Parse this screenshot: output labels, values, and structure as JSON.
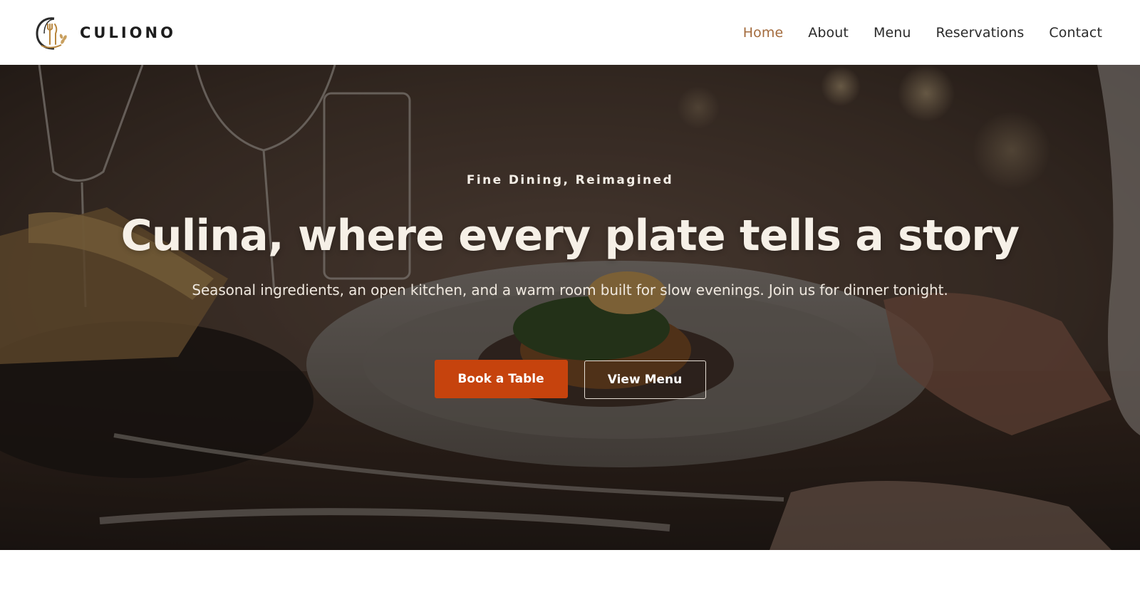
{
  "brand": {
    "name": "CULIONO",
    "logo_icon": "fork-knife-wheat-logo",
    "accent": "#a36b3d"
  },
  "nav": {
    "items": [
      {
        "label": "Home",
        "active": true
      },
      {
        "label": "About",
        "active": false
      },
      {
        "label": "Menu",
        "active": false
      },
      {
        "label": "Reservations",
        "active": false
      },
      {
        "label": "Contact",
        "active": false
      }
    ]
  },
  "hero": {
    "eyebrow": "Fine Dining, Reimagined",
    "headline": "Culina, where every plate tells a story",
    "subline": "Seasonal ingredients, an open kitchen, and a warm room built for slow evenings. Join us for dinner tonight.",
    "primary_cta": "Book a Table",
    "secondary_cta": "View Menu",
    "primary_color": "#c6430d"
  }
}
